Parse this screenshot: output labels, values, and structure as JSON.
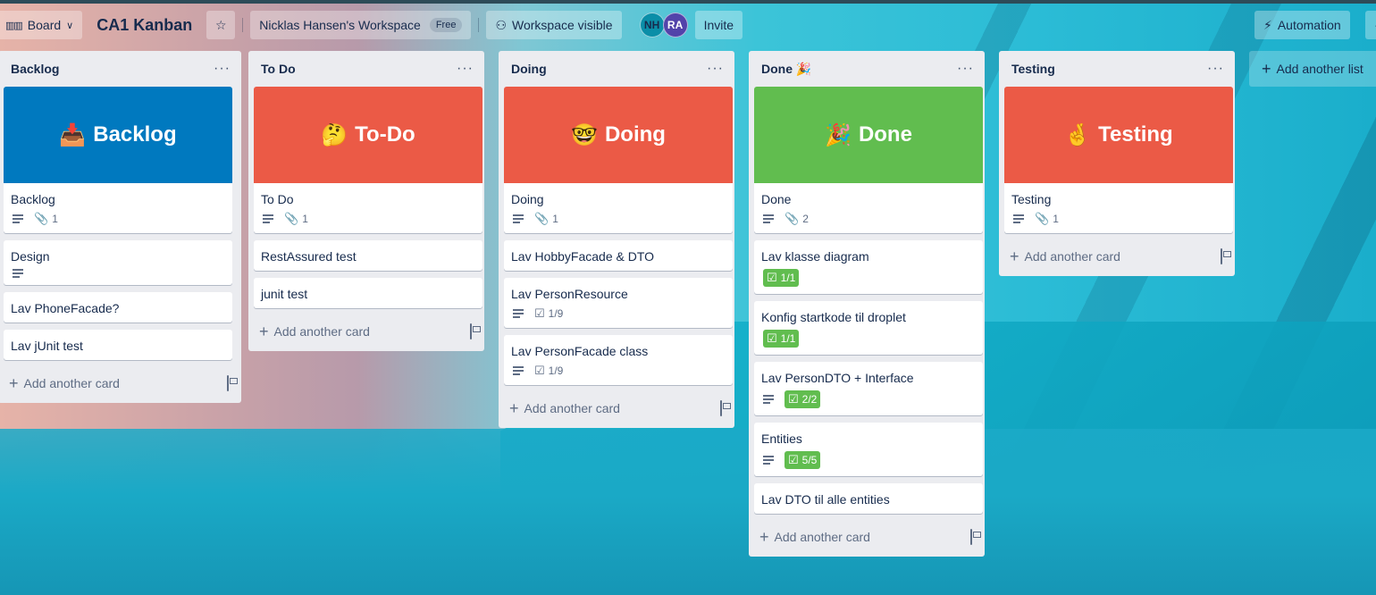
{
  "header": {
    "board_button": "Board",
    "board_title": "CA1 Kanban",
    "workspace_name": "Nicklas Hansen's Workspace",
    "workspace_plan": "Free",
    "visibility": "Workspace visible",
    "members": [
      {
        "initials": "NH"
      },
      {
        "initials": "RA"
      }
    ],
    "invite": "Invite",
    "automation": "Automation"
  },
  "add_card_label": "Add another card",
  "add_list_label": "Add another list",
  "lists": [
    {
      "title": "Backlog",
      "cover": {
        "text": "Backlog",
        "emoji": "📥",
        "color": "#0079bf"
      },
      "cards": [
        {
          "title": "Backlog",
          "description": true,
          "attachments": "1"
        },
        {
          "title": "Design",
          "description": true
        },
        {
          "title": "Lav PhoneFacade?"
        },
        {
          "title": "Lav jUnit test"
        }
      ]
    },
    {
      "title": "To Do",
      "cover": {
        "text": "To-Do",
        "emoji": "🤔",
        "color": "#eb5a46"
      },
      "cards": [
        {
          "title": "To Do",
          "description": true,
          "attachments": "1"
        },
        {
          "title": "RestAssured test"
        },
        {
          "title": "junit test"
        }
      ]
    },
    {
      "title": "Doing",
      "cover": {
        "text": "Doing",
        "emoji": "🤓",
        "color": "#eb5a46"
      },
      "cards": [
        {
          "title": "Doing",
          "description": true,
          "attachments": "1"
        },
        {
          "title": "Lav HobbyFacade & DTO"
        },
        {
          "title": "Lav PersonResource",
          "description": true,
          "checklist": "1/9"
        },
        {
          "title": "Lav PersonFacade class",
          "description": true,
          "checklist": "1/9"
        }
      ]
    },
    {
      "title": "Done 🎉",
      "cover": {
        "text": "Done",
        "emoji": "🎉",
        "color": "#61bd4f"
      },
      "cards": [
        {
          "title": "Done",
          "description": true,
          "attachments": "2"
        },
        {
          "title": "Lav klasse diagram",
          "checklist_complete": "1/1"
        },
        {
          "title": "Konfig startkode til droplet",
          "checklist_complete": "1/1"
        },
        {
          "title": "Lav PersonDTO + Interface",
          "description": true,
          "checklist_complete": "2/2"
        },
        {
          "title": "Entities",
          "description": true,
          "checklist_complete": "5/5"
        },
        {
          "title": "Lav DTO til alle entities"
        }
      ]
    },
    {
      "title": "Testing",
      "cover": {
        "text": "Testing",
        "emoji": "🤞",
        "color": "#eb5a46"
      },
      "cards": [
        {
          "title": "Testing",
          "description": true,
          "attachments": "1"
        }
      ]
    }
  ],
  "icons": {
    "board": "board-icon",
    "chevron": "chevron-down-icon",
    "star": "star-icon",
    "visibility": "people-icon",
    "automation": "lightning-icon",
    "description": "description-icon",
    "attachment": "paperclip-icon",
    "checklist": "checklist-icon",
    "template": "card-template-icon",
    "plus": "plus-icon",
    "menu": "ellipsis-icon"
  },
  "colors": {
    "list_bg": "#ebecf0",
    "blue": "#0079bf",
    "red": "#eb5a46",
    "green": "#61bd4f"
  }
}
